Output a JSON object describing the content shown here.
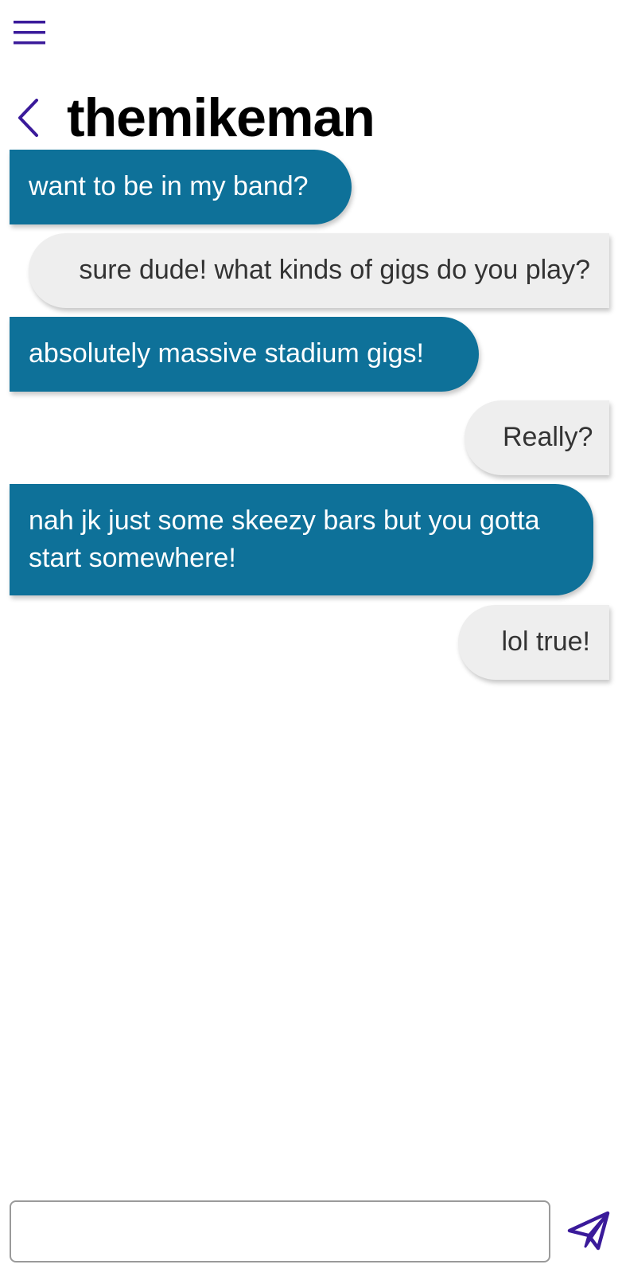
{
  "header": {
    "title": "themikeman"
  },
  "icons": {
    "menu": "hamburger-menu-icon",
    "back": "chevron-left-icon",
    "send": "paper-plane-icon"
  },
  "colors": {
    "accent": "#3a1a9a",
    "sent_bubble": "#0e7199",
    "received_bubble": "#eeeeee",
    "sent_text": "#ffffff",
    "received_text": "#333333"
  },
  "messages": [
    {
      "direction": "sent",
      "text": "want to be in my band?"
    },
    {
      "direction": "received",
      "text": "sure dude! what kinds of gigs do you play?"
    },
    {
      "direction": "sent",
      "text": "absolutely massive stadium gigs!"
    },
    {
      "direction": "received",
      "text": "Really?"
    },
    {
      "direction": "sent",
      "text": "nah jk just some skeezy bars but you gotta start somewhere!"
    },
    {
      "direction": "received",
      "text": "lol true!"
    }
  ],
  "composer": {
    "value": "",
    "placeholder": ""
  }
}
